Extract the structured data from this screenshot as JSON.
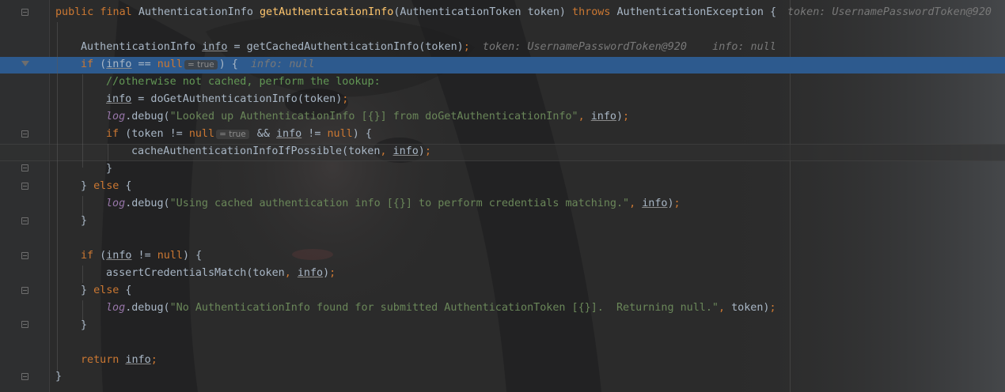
{
  "editor": {
    "theme_colors": {
      "background": "#2b2b2b",
      "keyword": "#cc7832",
      "method": "#ffc66d",
      "string": "#6a8759",
      "comment": "#629755",
      "field": "#9876aa",
      "selection": "#2d5a8e"
    },
    "line1": {
      "t1": "public final ",
      "t2": "AuthenticationInfo ",
      "fn": "getAuthenticationInfo",
      "t3": "(AuthenticationToken token) ",
      "kw": "throws",
      "t4": " AuthenticationException {",
      "inline": "token: UsernamePasswordToken@920"
    },
    "line2": {
      "t1": "AuthenticationInfo ",
      "var": "info",
      "t2": " = getCachedAuthenticationInfo(token)",
      "semi": ";",
      "inline1": "token: UsernamePasswordToken@920",
      "inline2": "info: null"
    },
    "line3": {
      "kw1": "if",
      "t1": " (",
      "var": "info",
      "t2": " == ",
      "kw2": "null",
      "hint": "= true",
      "t3": ") {",
      "inline": "info: null"
    },
    "line4": {
      "comment": "//otherwise not cached, perform the lookup:"
    },
    "line5": {
      "var": "info",
      "t1": " = doGetAuthenticationInfo(token)",
      "semi": ";"
    },
    "line6": {
      "field": "log",
      "t1": ".debug(",
      "str": "\"Looked up AuthenticationInfo [{}] from doGetAuthenticationInfo\"",
      "comma": ", ",
      "var": "info",
      "t2": ")",
      "semi": ";"
    },
    "line7": {
      "kw1": "if",
      "t1": " (token != ",
      "kw2": "null",
      "hint": "= true",
      "t2": " && ",
      "var": "info",
      "t3": " != ",
      "kw3": "null",
      "t4": ") {"
    },
    "line8": {
      "t1": "cacheAuthenticationInfoIfPossible(token",
      "comma": ", ",
      "var": "info",
      "t2": ")",
      "semi": ";"
    },
    "line9": {
      "t1": "}"
    },
    "line10": {
      "t1": "} ",
      "kw": "else",
      "t2": " {"
    },
    "line11": {
      "field": "log",
      "t1": ".debug(",
      "str": "\"Using cached authentication info [{}] to perform credentials matching.\"",
      "comma": ", ",
      "var": "info",
      "t2": ")",
      "semi": ";"
    },
    "line12": {
      "t1": "}"
    },
    "line14": {
      "kw1": "if",
      "t1": " (",
      "var": "info",
      "t2": " != ",
      "kw2": "null",
      "t3": ") {"
    },
    "line15": {
      "t1": "assertCredentialsMatch(token",
      "comma": ", ",
      "var": "info",
      "t2": ")",
      "semi": ";"
    },
    "line16": {
      "t1": "} ",
      "kw": "else",
      "t2": " {"
    },
    "line17": {
      "field": "log",
      "t1": ".debug(",
      "str": "\"No AuthenticationInfo found for submitted AuthenticationToken [{}].  Returning null.\"",
      "comma": ", ",
      "t2": "token)",
      "semi": ";"
    },
    "line18": {
      "t1": "}"
    },
    "line20": {
      "kw": "return",
      "sp": " ",
      "var": "info",
      "semi": ";"
    },
    "line21": {
      "t1": "}"
    }
  }
}
